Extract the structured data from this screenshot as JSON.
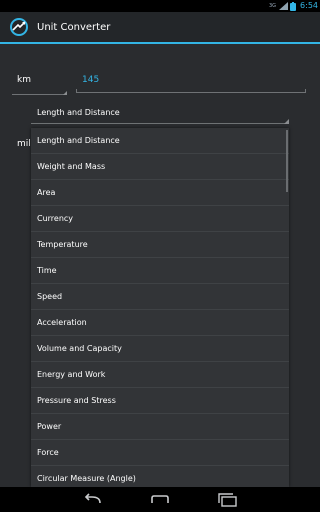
{
  "status_bar": {
    "signal_label": "3G",
    "time": "6:54",
    "icons": [
      "signal-icon",
      "wifi-icon",
      "battery-icon"
    ]
  },
  "action_bar": {
    "app_icon": "app-logo-icon",
    "title": "Unit Converter"
  },
  "converter": {
    "from_unit": "km",
    "from_value": "145",
    "to_unit": "mile",
    "category_selected": "Length and Distance"
  },
  "category_dropdown": {
    "items": [
      "Length and Distance",
      "Weight and Mass",
      "Area",
      "Currency",
      "Temperature",
      "Time",
      "Speed",
      "Acceleration",
      "Volume and Capacity",
      "Energy and Work",
      "Pressure and Stress",
      "Power",
      "Force",
      "Circular Measure (Angle)"
    ]
  },
  "nav_bar": {
    "icons": [
      "back-icon",
      "home-icon",
      "recent-apps-icon"
    ]
  },
  "colors": {
    "accent": "#33b5e5",
    "content_bg": "#2a2c2f",
    "action_bar_bg": "#232629",
    "popup_bg": "#323437"
  }
}
